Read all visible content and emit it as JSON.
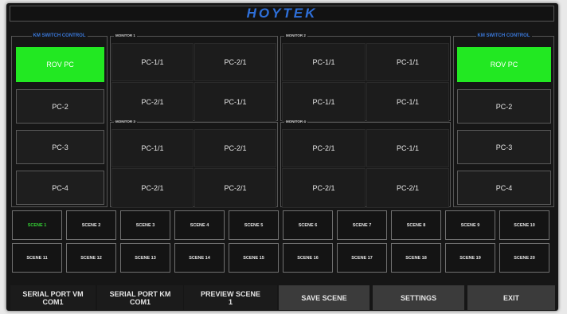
{
  "brand": "HOYTEK",
  "km_left": {
    "legend": "KM SWITCH CONTROL",
    "buttons": [
      "ROV PC",
      "PC-2",
      "PC-3",
      "PC-4"
    ]
  },
  "km_right": {
    "legend": "KM SWITCH CONTROL",
    "buttons": [
      "ROV PC",
      "PC-2",
      "PC-3",
      "PC-4"
    ]
  },
  "monitors": [
    {
      "legend": "MONITOR 1",
      "cells": [
        "PC-1/1",
        "PC-2/1",
        "PC-2/1",
        "PC-1/1"
      ]
    },
    {
      "legend": "MONITOR 2",
      "cells": [
        "PC-1/1",
        "PC-1/1",
        "PC-1/1",
        "PC-1/1"
      ]
    },
    {
      "legend": "MONITOR 3",
      "cells": [
        "PC-1/1",
        "PC-2/1",
        "PC-2/1",
        "PC-2/1"
      ]
    },
    {
      "legend": "MONITOR 4",
      "cells": [
        "PC-2/1",
        "PC-1/1",
        "PC-2/1",
        "PC-2/1"
      ]
    }
  ],
  "scenes": [
    "SCENE 1",
    "SCENE 2",
    "SCENE 3",
    "SCENE 4",
    "SCENE 5",
    "SCENE 6",
    "SCENE 7",
    "SCENE 8",
    "SCENE 9",
    "SCENE 10",
    "SCENE 11",
    "SCENE 12",
    "SCENE 13",
    "SCENE 14",
    "SCENE 15",
    "SCENE 16",
    "SCENE 17",
    "SCENE 18",
    "SCENE 19",
    "SCENE 20"
  ],
  "active_scene": "SCENE 1",
  "bottom": {
    "serial_vm_label": "SERIAL PORT VM",
    "serial_vm_value": "COM1",
    "serial_km_label": "SERIAL PORT KM",
    "serial_km_value": "COM1",
    "preview_label": "PREVIEW SCENE",
    "preview_value": "1",
    "save_label": "SAVE SCENE",
    "settings_label": "SETTINGS",
    "exit_label": "EXIT"
  },
  "colors": {
    "active_green": "#22e822",
    "scene_active_text": "#34d034",
    "brand_blue": "#2e6fd8"
  }
}
